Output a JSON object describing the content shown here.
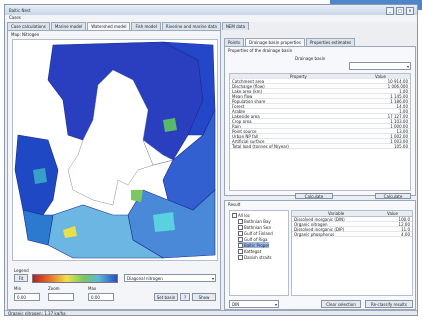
{
  "window": {
    "title": "Baltic Nest",
    "controls": [
      "_",
      "□",
      "×"
    ]
  },
  "menu": {
    "items": [
      "Cases"
    ]
  },
  "tabs": [
    "Case calculations",
    "Marine model",
    "Watershed model",
    "Fish model",
    "Riverine and marine data",
    "NEM data"
  ],
  "active_tab": 2,
  "map_panel": {
    "label": "Map: Nitrogen",
    "legend_label": "Legend",
    "fit_button": "Fit",
    "scale_labels": [
      "Min",
      "Zoom",
      "Max"
    ],
    "scale_values": [
      "0.00",
      "",
      "0.00"
    ],
    "layer_select": "Diagonal nitrogen",
    "buttons": [
      "Set basin",
      "?",
      "Show"
    ]
  },
  "properties": {
    "tabs": [
      "Points",
      "Drainage basin properties",
      "Properties estimates"
    ],
    "active_tab": 1,
    "header": "Properties of the drainage basin",
    "basin_label": "Drainage basin",
    "columns": [
      "Property",
      "Value"
    ],
    "rows": [
      {
        "name": "Catchment area",
        "value": "10 914.00"
      },
      {
        "name": "Discharge (flow)",
        "value": "1 006.000"
      },
      {
        "name": "Lake area (km)",
        "value": "1.00"
      },
      {
        "name": "Mean flow",
        "value": "1 145.00"
      },
      {
        "name": "Population share",
        "value": "1 186.00"
      },
      {
        "name": "Forest",
        "value": "14.00"
      },
      {
        "name": "Arable",
        "value": "1.00"
      },
      {
        "name": "Lakeside area",
        "value": "17 127.00"
      },
      {
        "name": "Crop area",
        "value": "1 103.00"
      },
      {
        "name": "Rain",
        "value": "1 000.00"
      },
      {
        "name": "Point source",
        "value": "13.00"
      },
      {
        "name": "Urban NP fall",
        "value": "1 002.00"
      },
      {
        "name": "Artificial surface",
        "value": "1 003.00"
      },
      {
        "name": "Total load (tonnes of N/year)",
        "value": "105.00"
      }
    ],
    "footer_button_left": "Calculate",
    "footer_button_right": "Calculate"
  },
  "results": {
    "label": "Result",
    "tree_root": "All loc",
    "tree_items": [
      "Bothnian Bay",
      "Bothnian Sea",
      "Gulf of Finland",
      "Gulf of Riga",
      "Baltic Proper",
      "Kattegat",
      "Danish straits"
    ],
    "tbl_columns": [
      "Variable",
      "Value"
    ],
    "tbl_rows": [
      {
        "name": "Dissolved inorganic (DIN)",
        "value": "100.0"
      },
      {
        "name": "Organic nitrogen",
        "value": "12.00"
      },
      {
        "name": "Dissolved inorganic (DIP)",
        "value": "11.0"
      },
      {
        "name": "Organic phosphorus",
        "value": "4.00"
      }
    ],
    "bottom_select": "DIN",
    "bottom_buttons": [
      "Clear selection",
      "Re-classify results"
    ]
  },
  "status": "Organic nitrogen: 1.37 kg/ha",
  "colors": {
    "accent": "#4f86c9",
    "sea": "#ffffff",
    "land": "#2a4cc4"
  }
}
